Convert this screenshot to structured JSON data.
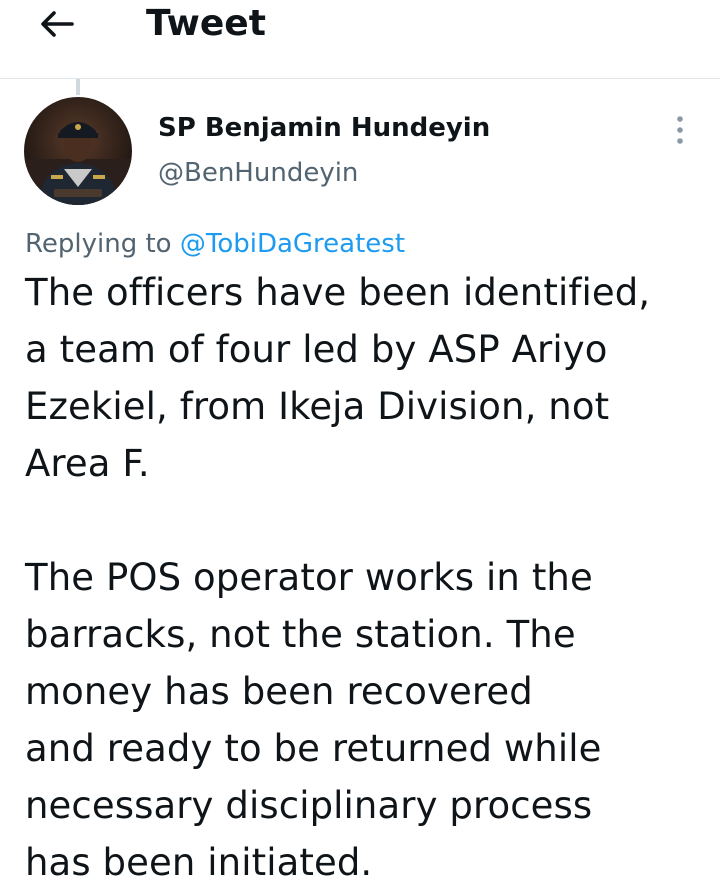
{
  "header": {
    "title": "Tweet"
  },
  "tweet": {
    "author": {
      "display_name": "SP Benjamin Hundeyin",
      "handle": "@BenHundeyin"
    },
    "replying_prefix": "Replying to ",
    "replying_to": "@TobiDaGreatest",
    "paragraph_1": [
      "The officers have been identified,",
      "a team of four led by ASP Ariyo",
      "Ezekiel, from Ikeja Division, not",
      "Area F."
    ],
    "paragraph_2": [
      "The POS operator works in the",
      "barracks, not the station. The",
      "money has been recovered",
      "and ready to be returned while",
      "necessary disciplinary process",
      "has been initiated."
    ]
  },
  "colors": {
    "text": "#0f1419",
    "secondary": "#536471",
    "link": "#1d9bf0",
    "divider": "#e1e6ea"
  },
  "icons": {
    "back": "arrow-left-icon",
    "more": "more-vertical-icon",
    "avatar": "profile-photo"
  }
}
